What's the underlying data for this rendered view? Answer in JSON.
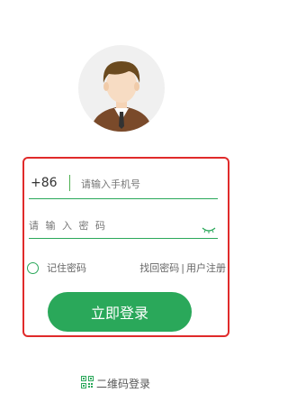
{
  "colors": {
    "accent": "#2aa85a",
    "highlight_border": "#e02a2a"
  },
  "avatar": {
    "icon": "user-avatar-icon"
  },
  "phone": {
    "country_code": "+86",
    "placeholder": "请输入手机号"
  },
  "password": {
    "placeholder": "请 输 入 密 码",
    "toggle_icon": "eye-closed-icon"
  },
  "remember": {
    "label": "记住密码"
  },
  "links": {
    "forgot": "找回密码",
    "separator": "|",
    "register": "用户注册"
  },
  "login_button": {
    "label": "立即登录"
  },
  "qr_login": {
    "icon": "qr-code-icon",
    "label": "二维码登录"
  }
}
